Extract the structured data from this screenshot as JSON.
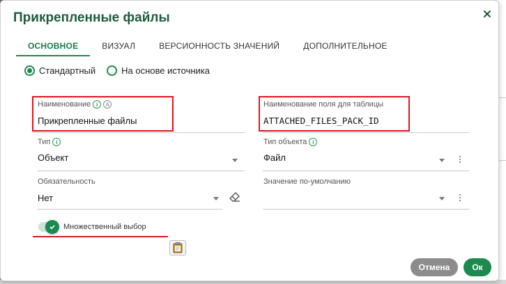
{
  "dialog": {
    "title": "Прикрепленные файлы",
    "close_icon": "close-icon"
  },
  "tabs": [
    {
      "label": "ОСНОВНОЕ",
      "active": true
    },
    {
      "label": "ВИЗУАЛ",
      "active": false
    },
    {
      "label": "ВЕРСИОННОСТЬ ЗНАЧЕНИЙ",
      "active": false
    },
    {
      "label": "ДОПОЛНИТЕЛЬНОЕ",
      "active": false
    }
  ],
  "source_mode": {
    "options": [
      {
        "label": "Стандартный",
        "selected": true
      },
      {
        "label": "На основе источника",
        "selected": false
      }
    ]
  },
  "fields": {
    "name": {
      "label": "Наименование",
      "value": "Прикрепленные файлы",
      "auto_badge": "A"
    },
    "table_field_name": {
      "label": "Наименование поля для таблицы",
      "value": "ATTACHED_FILES_PACK_ID"
    },
    "type": {
      "label": "Тип",
      "value": "Объект"
    },
    "object_type": {
      "label": "Тип объекта",
      "value": "Файл"
    },
    "required": {
      "label": "Обязательность",
      "value": "Нет"
    },
    "default_value": {
      "label": "Значение по-умолчанию",
      "value": ""
    }
  },
  "multiple_choice": {
    "label": "Множественный выбор",
    "checked": true
  },
  "buttons": {
    "cancel": "Отмена",
    "ok": "Ок"
  },
  "colors": {
    "accent": "#1a8a4e",
    "title": "#1e5c3a",
    "highlight": "#e0141e",
    "cancel": "#8c8c8c"
  }
}
